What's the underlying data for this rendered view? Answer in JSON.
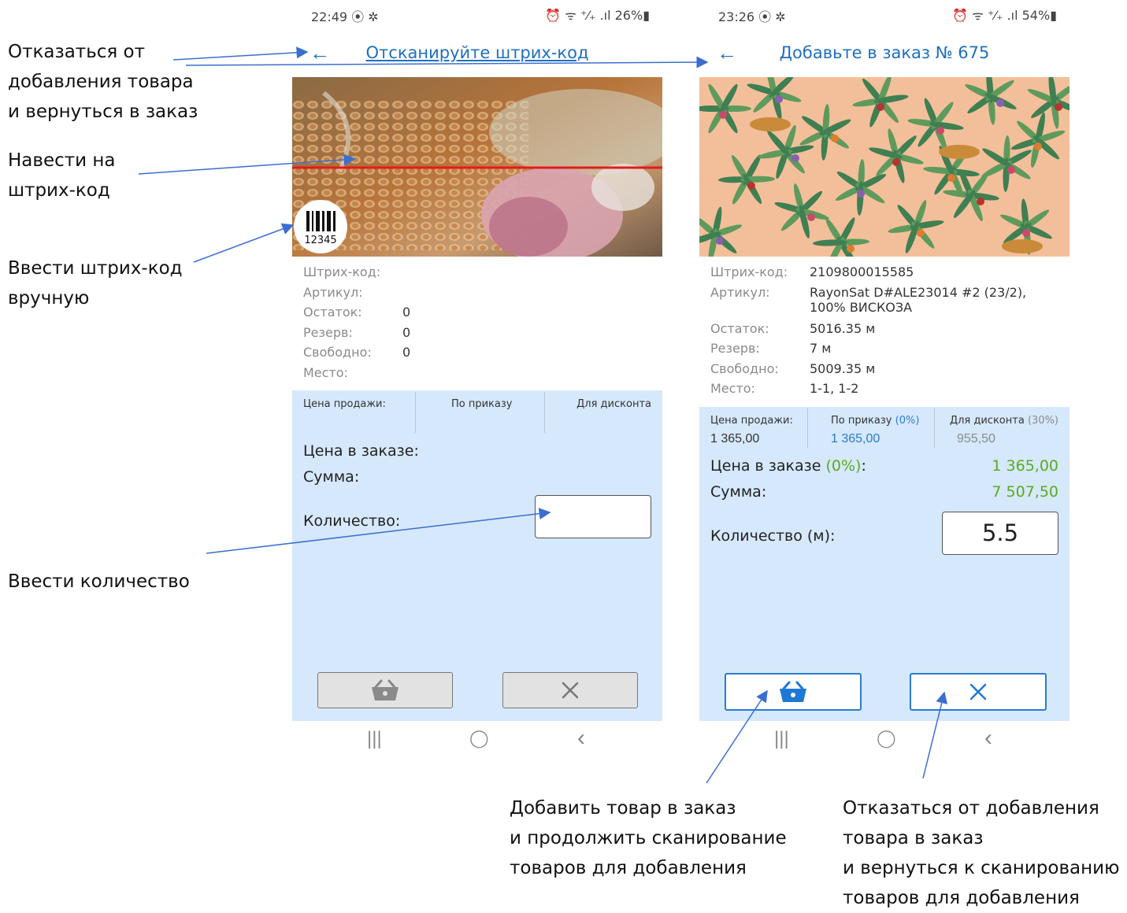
{
  "annotations": {
    "back": [
      "Отказаться от",
      "добавления товара",
      "и вернуться в заказ"
    ],
    "aim": [
      "Навести на",
      "штрих-код"
    ],
    "manual": [
      "Ввести штрих-код",
      "вручную"
    ],
    "quantity": [
      "Ввести количество"
    ],
    "add": [
      "Добавить товар в заказ",
      "и продолжить сканирование",
      "товаров для добавления"
    ],
    "cancel": [
      "Отказаться от добавления",
      "товара в заказ",
      "и вернуться к сканированию",
      "товаров для добавления"
    ]
  },
  "left_screen": {
    "status_time": "22:49 ⦿ ✲",
    "status_icons": "⏰ ᯤ ⁺⁄₊ .ıl 26%▮",
    "title": "Отсканируйте штрих-код",
    "barcode_digits": "12345",
    "info": [
      {
        "label": "Штрих-код:",
        "value": ""
      },
      {
        "label": "Артикул:",
        "value": ""
      },
      {
        "label": "Остаток:",
        "value": "0"
      },
      {
        "label": "Резерв:",
        "value": "0"
      },
      {
        "label": "Свободно:",
        "value": "0"
      },
      {
        "label": "Место:",
        "value": ""
      }
    ],
    "price_headers": [
      "Цена продажи:",
      "По приказу",
      "Для дисконта"
    ],
    "order_price_label": "Цена в заказе:",
    "sum_label": "Сумма:",
    "quantity_label": "Количество:",
    "quantity_value": ""
  },
  "right_screen": {
    "status_time": "23:26 ⦿ ✲",
    "status_icons": "⏰ ᯤ ⁺⁄₊ .ıl 54%▮",
    "title": "Добавьте в заказ № 675",
    "info": [
      {
        "label": "Штрих-код:",
        "value": "2109800015585"
      },
      {
        "label": "Артикул:",
        "value": "RayonSat D#ALE23014 #2 (23/2),",
        "value2": "100% ВИСКОЗА"
      },
      {
        "label": "Остаток:",
        "value": "5016.35 м"
      },
      {
        "label": "Резерв:",
        "value": "7 м"
      },
      {
        "label": "Свободно:",
        "value": "5009.35 м"
      },
      {
        "label": "Место:",
        "value": "1-1, 1-2"
      }
    ],
    "price_headers": [
      {
        "text": "Цена продажи:",
        "pct": ""
      },
      {
        "text": "По приказу",
        "pct": "(0%)"
      },
      {
        "text": "Для дисконта",
        "pct": "(30%)"
      }
    ],
    "price_values": [
      "1 365,00",
      "1 365,00",
      "955,50"
    ],
    "order_price_label": "Цена в заказе",
    "order_price_pct": "(0%)",
    "order_price_colon": ":",
    "order_price_value": "1 365,00",
    "sum_label": "Сумма:",
    "sum_value": "7 507,50",
    "quantity_label": "Количество (м):",
    "quantity_value": "5.5"
  },
  "nav": {
    "recent": "|||",
    "home": "◯",
    "back": "‹"
  },
  "colors": {
    "accent": "#1f6fbf",
    "green": "#5aaa1e",
    "panel": "#d6e8fb",
    "arrow": "#3a6fd0",
    "scanline": "#e31b1b"
  }
}
